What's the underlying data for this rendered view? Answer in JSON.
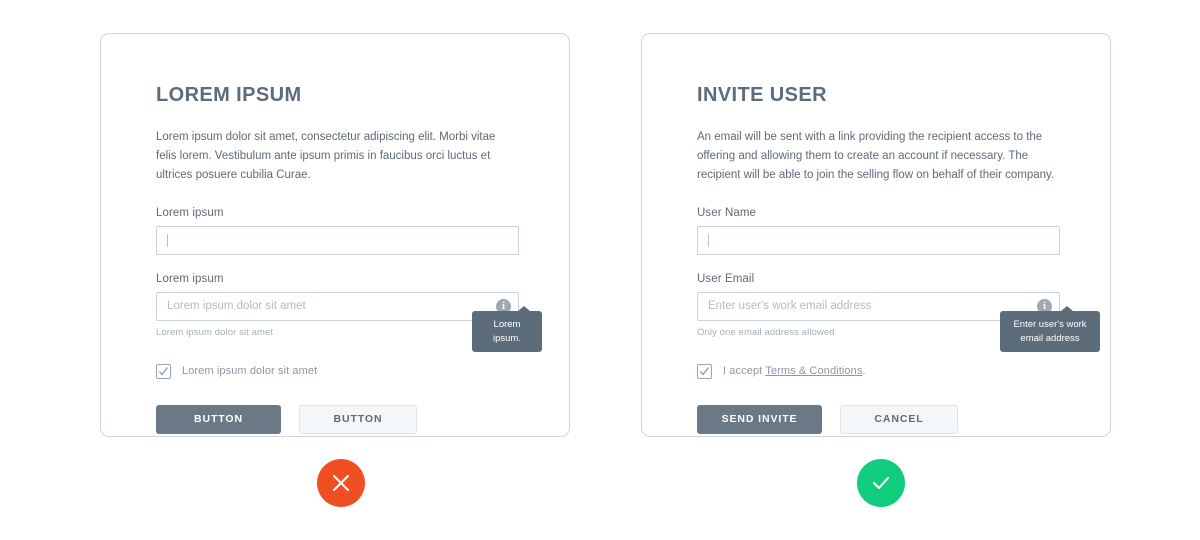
{
  "left_card": {
    "title": "LOREM IPSUM",
    "description": "Lorem ipsum dolor sit amet, consectetur adipiscing elit. Morbi vitae felis lorem. Vestibulum ante ipsum primis in faucibus orci luctus et ultrices posuere cubilia Curae.",
    "field1": {
      "label": "Lorem ipsum",
      "value": "",
      "placeholder": ""
    },
    "field2": {
      "label": "Lorem ipsum",
      "value": "",
      "placeholder": "Lorem ipsum dolor sit amet",
      "helper": "Lorem ipsum dolor sit amet",
      "info_icon": "info-icon",
      "tooltip": "Lorem ipsum."
    },
    "checkbox": {
      "label": "Lorem ipsum dolor sit amet",
      "checked": true
    },
    "primary_button": "BUTTON",
    "secondary_button": "BUTTON",
    "status": {
      "icon": "cross-icon",
      "color": "#f04e23"
    }
  },
  "right_card": {
    "title": "INVITE USER",
    "description": "An email will be sent with a link providing the recipient access to the offering and allowing them to create an account if necessary. The recipient will be able to join the selling flow on behalf of their company.",
    "field1": {
      "label": "User Name",
      "value": "",
      "placeholder": ""
    },
    "field2": {
      "label": "User Email",
      "value": "",
      "placeholder": "Enter user's work email address",
      "helper": "Only one email address allowed",
      "info_icon": "info-icon",
      "tooltip": "Enter user's work email address"
    },
    "checkbox": {
      "label_prefix": "I accept ",
      "link_text": "Terms & Conditions",
      "label_suffix": ".",
      "checked": true
    },
    "primary_button": "SEND INVITE",
    "secondary_button": "CANCEL",
    "status": {
      "icon": "check-icon",
      "color": "#0fcd7c"
    }
  },
  "theme": {
    "card_border": "#ccd5e0",
    "title_color": "#5d6c7b",
    "primary_button_bg": "#6b7885",
    "secondary_button_bg": "#f4f7fa",
    "tooltip_bg": "#5d6c7b",
    "fail_color": "#f04e23",
    "success_color": "#0fcd7c"
  }
}
